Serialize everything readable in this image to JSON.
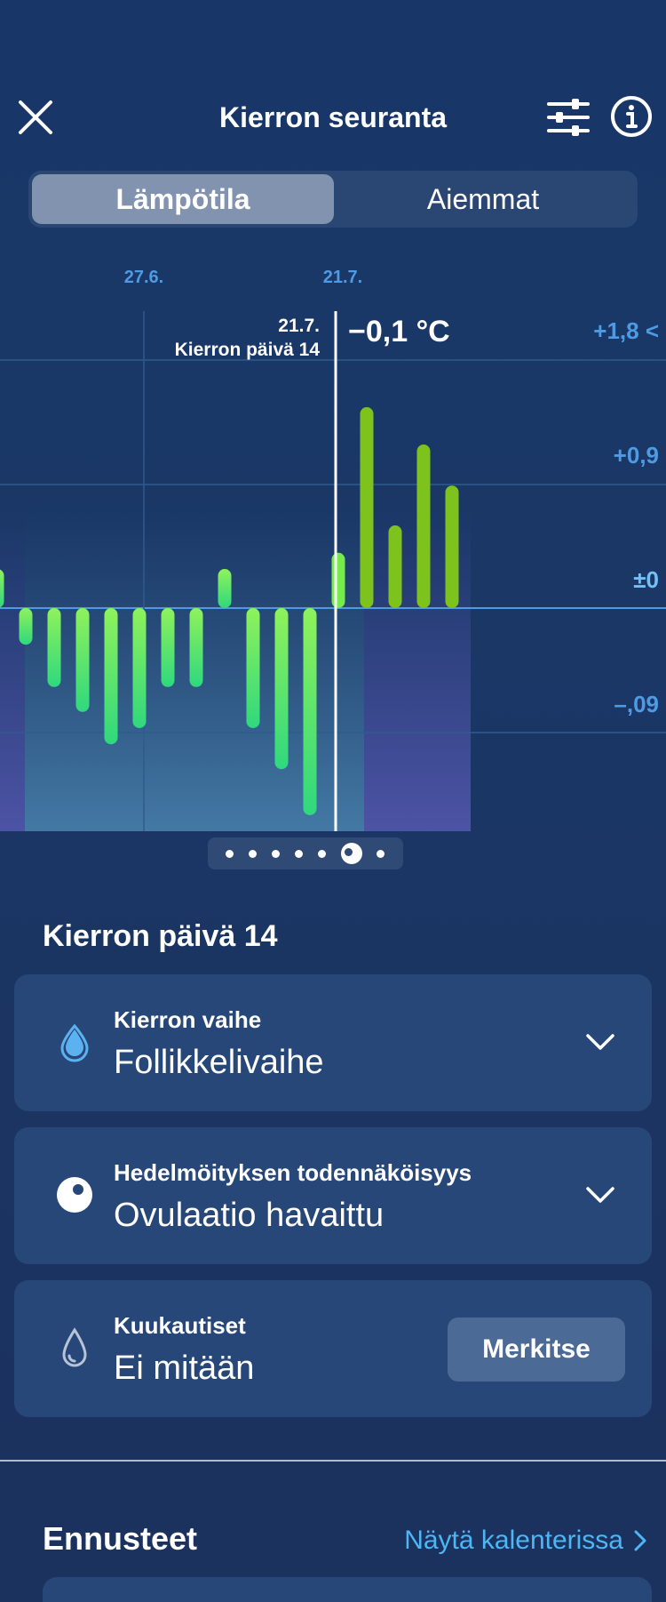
{
  "header": {
    "title": "Kierron seuranta",
    "icons": {
      "close": "close-icon",
      "filter": "sliders-icon",
      "info": "info-icon"
    }
  },
  "segment": {
    "active": "Lämpötila",
    "inactive": "Aiemmat"
  },
  "chart_data": {
    "type": "bar",
    "x_tick_labels": [
      "27.6.",
      "21.7."
    ],
    "y_tick_labels": [
      "+1,8 <",
      "+0,9",
      "±0",
      "–,09"
    ],
    "selected": {
      "date": "21.7.",
      "cycle_day": "Kierron päivä 14",
      "value_label": "−0,1 °C"
    },
    "ylim": [
      -0.18,
      0.18
    ],
    "bars": [
      {
        "v": 0.03,
        "phase": "follicular"
      },
      {
        "v": -0.028,
        "phase": "follicular"
      },
      {
        "v": -0.062,
        "phase": "follicular"
      },
      {
        "v": -0.082,
        "phase": "follicular"
      },
      {
        "v": -0.108,
        "phase": "follicular"
      },
      {
        "v": -0.095,
        "phase": "follicular"
      },
      {
        "v": -0.062,
        "phase": "follicular"
      },
      {
        "v": -0.062,
        "phase": "follicular"
      },
      {
        "v": 0.03,
        "phase": "follicular"
      },
      {
        "v": -0.095,
        "phase": "follicular"
      },
      {
        "v": -0.128,
        "phase": "follicular"
      },
      {
        "v": -0.165,
        "phase": "follicular"
      },
      {
        "v": 0.043,
        "phase": "ovulation"
      },
      {
        "v": 0.16,
        "phase": "luteal"
      },
      {
        "v": 0.065,
        "phase": "luteal"
      },
      {
        "v": 0.13,
        "phase": "luteal"
      },
      {
        "v": 0.097,
        "phase": "luteal"
      }
    ],
    "colors": {
      "follicular": "#5ff07a",
      "luteal": "#7ec31d",
      "accent": "#4e9be3"
    }
  },
  "pager": {
    "count": 7,
    "current": 5
  },
  "section_title": "Kierron päivä 14",
  "cards": [
    {
      "label": "Kierron vaihe",
      "value": "Follikkelivaihe",
      "icon": "drop-phase-icon"
    },
    {
      "label": "Hedelmöityksen todennäköisyys",
      "value": "Ovulaatio havaittu",
      "icon": "ovulation-icon"
    },
    {
      "label": "Kuukautiset",
      "value": "Ei mitään",
      "icon": "drop-outline-icon",
      "button": "Merkitse"
    }
  ],
  "forecast": {
    "title": "Ennusteet",
    "link": "Näytä kalenterissa"
  }
}
